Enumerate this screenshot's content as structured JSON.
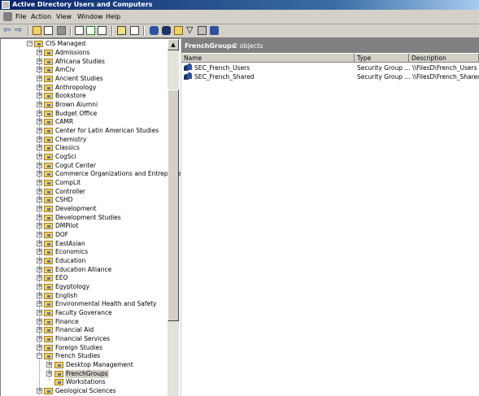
{
  "window": {
    "title": "Active Directory Users and Computers"
  },
  "menu": [
    "File",
    "Action",
    "View",
    "Window",
    "Help"
  ],
  "toolbar": {
    "icons": [
      "back-icon",
      "forward-icon",
      "up-icon",
      "show-tree-icon",
      "delete-icon",
      "properties-icon",
      "refresh-icon",
      "export-icon",
      "help-icon",
      "view-icon",
      "new-user-icon",
      "new-group-icon",
      "new-ou-icon",
      "filter-icon",
      "find-icon",
      "add-to-group-icon"
    ]
  },
  "tree": {
    "root": "CIS Managed",
    "items": [
      "Admissions",
      "Africana Studies",
      "AmCiv",
      "Ancient Studies",
      "Anthropology",
      "Bookstore",
      "Brown Alumni",
      "Budget Office",
      "CAMR",
      "Center for Latin American Studies",
      "Chemistry",
      "Classics",
      "CogSci",
      "Cogut Center",
      "Commerce Organizations and Entrepreneurs",
      "CompLit",
      "Controller",
      "CSHD",
      "Development",
      "Development Studies",
      "DMPilot",
      "DOF",
      "EastAsian",
      "Economics",
      "Education",
      "Education Alliance",
      "EEO",
      "Egyptology",
      "English",
      "Environmental Health and Safety",
      "Faculty Goverance",
      "Finance",
      "Financial Aid",
      "Financial Services",
      "Foreign Studies",
      "French Studies"
    ],
    "french_children": [
      "Desktop Management",
      "FrenchGroups",
      "Workstations"
    ],
    "after": "Geological Sciences",
    "selected": "FrenchGroups"
  },
  "rightpane": {
    "header_title": "FrenchGroups",
    "header_count": "2 objects",
    "columns": [
      "Name",
      "Type",
      "Description"
    ],
    "rows": [
      {
        "name": "SEC_French_Users",
        "type": "Security Group ...",
        "description": "\\\\FilesD\\French_Users"
      },
      {
        "name": "SEC_French_Shared",
        "type": "Security Group ...",
        "description": "\\\\FilesD\\French_Shared"
      }
    ]
  },
  "colors": {
    "titlebar": "#0a246a",
    "folder": "#f0d060",
    "header": "#808080"
  }
}
